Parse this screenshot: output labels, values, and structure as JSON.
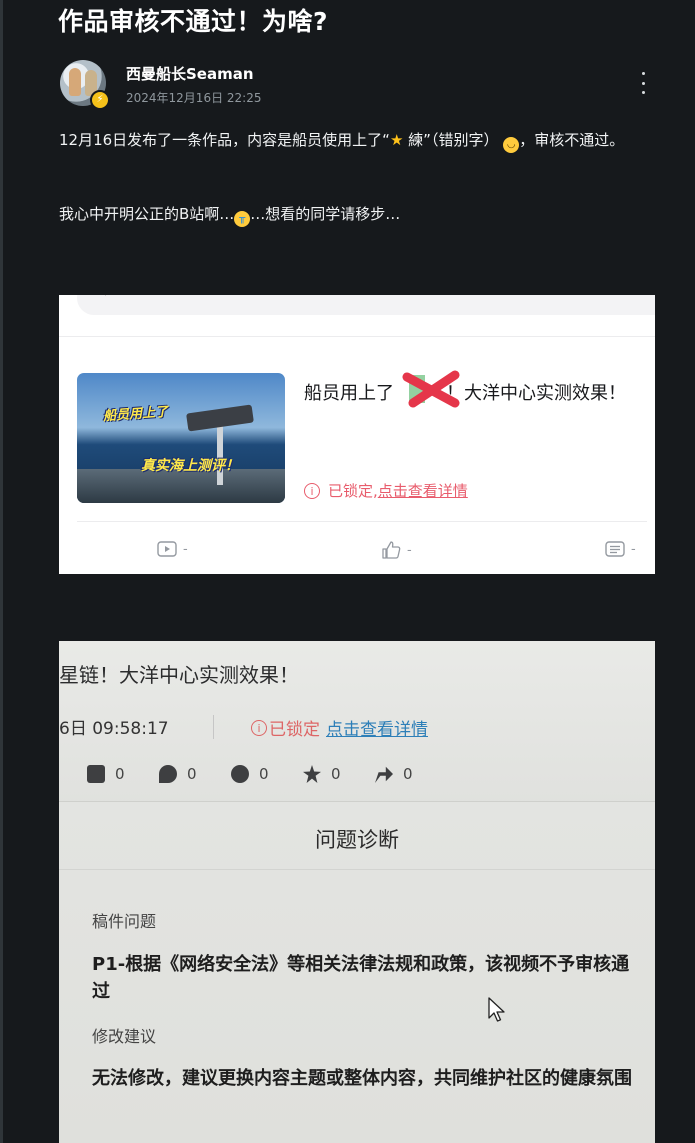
{
  "post": {
    "title": "作品审核不通过！为啥?",
    "author": "西曼船长Seaman",
    "time": "2024年12月16日 22:25",
    "para1": [
      "12月16日发布了一条作品，内容是船员使用上了“",
      " 練”（错别字）",
      "，审核不通过。"
    ],
    "para2": [
      "我心中开明公正的B站啊…",
      "…想看的同学请移步…"
    ]
  },
  "screenshot1": {
    "thumbnail_caption1": "船员用上了",
    "thumbnail_caption2": "真实海上测评！",
    "video_title_before": "船员用上了",
    "video_title_after": "！大洋中心实测效果！",
    "lock_text": "已锁定,",
    "lock_link": "点击查看详情",
    "stats": [
      "-",
      "-",
      "-"
    ]
  },
  "screenshot2": {
    "title_fragment": "星链！大洋中心实测效果！",
    "time_fragment": "6日 09:58:17",
    "lock_text": "已锁定",
    "lock_link": "点击查看详情",
    "stats": [
      "0",
      "0",
      "0",
      "0",
      "0"
    ],
    "diagnosis_title": "问题诊断",
    "issue_label": "稿件问题",
    "issue_text": "P1-根据《网络安全法》等相关法律法规和政策，该视频不予审核通过",
    "suggest_label": "修改建议",
    "suggest_text": "无法修改，建议更换内容主题或整体内容，共同维护社区的健康氛围"
  },
  "colors": {
    "background": "#16191c",
    "lock_red": "#e85c6c",
    "link_blue": "#2d7fb8",
    "badge_yellow": "#f5c11a"
  }
}
